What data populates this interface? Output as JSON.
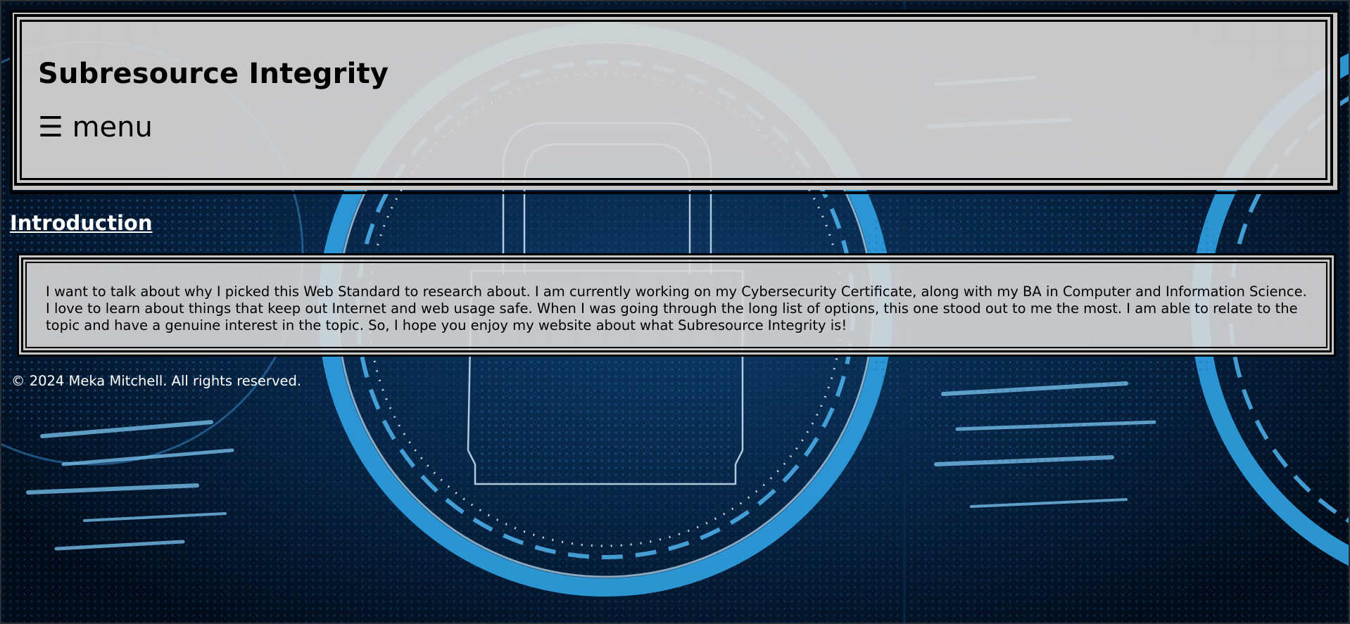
{
  "header": {
    "title": "Subresource Integrity",
    "menu_icon": "☰",
    "menu_label": "menu"
  },
  "main": {
    "section_heading": "Introduction",
    "intro_text": "I want to talk about why I picked this Web Standard to research about. I am currently working on my Cybersecurity Certificate, along with my BA in Computer and Information Science. I love to learn about things that keep out Internet and web usage safe. When I was going through the long list of options, this one stood out to me the most. I am able to relate to the topic and have a genuine interest in the topic. So, I hope you enjoy my website about what Subresource Integrity is!"
  },
  "footer": {
    "copyright": "© 2024 Meka Mitchell. All rights reserved."
  },
  "theme": {
    "background_dark": "#04182e",
    "accent_blue": "#2d9cdb",
    "panel_gray": "#d6d6d6"
  },
  "background_image": {
    "icon": "padlock-circuit-icon"
  }
}
